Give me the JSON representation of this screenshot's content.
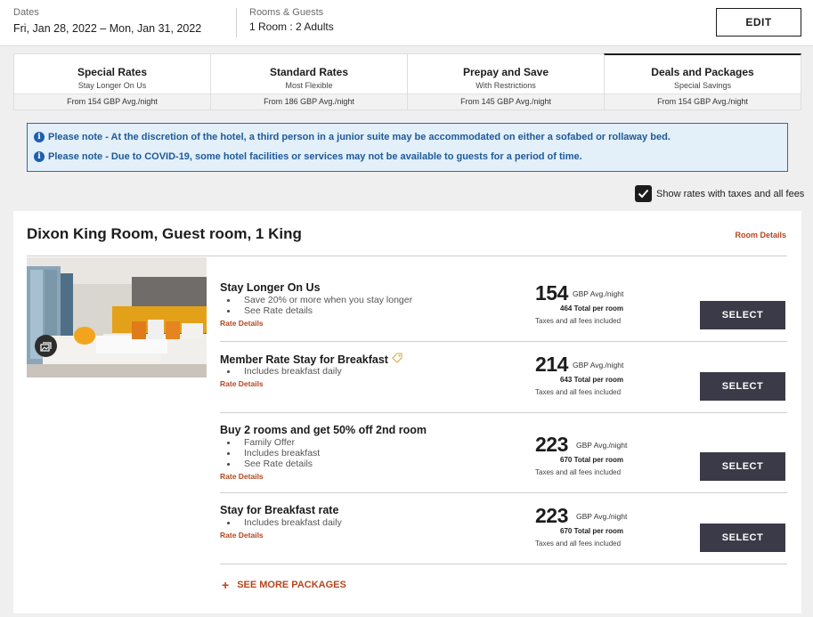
{
  "header": {
    "dates_label": "Dates",
    "dates_value": "Fri, Jan 28, 2022 – Mon, Jan 31, 2022",
    "guests_label": "Rooms & Guests",
    "guests_value": "1 Room : 2 Adults",
    "edit_label": "EDIT"
  },
  "tabs": [
    {
      "title": "Special Rates",
      "subtitle": "Stay Longer On Us",
      "from": "From 154 GBP Avg./night",
      "active": false
    },
    {
      "title": "Standard Rates",
      "subtitle": "Most Flexible",
      "from": "From 186 GBP Avg./night",
      "active": false
    },
    {
      "title": "Prepay and Save",
      "subtitle": "With Restrictions",
      "from": "From 145 GBP Avg./night",
      "active": false
    },
    {
      "title": "Deals and Packages",
      "subtitle": "Special Savings",
      "from": "From 154 GBP Avg./night",
      "active": true
    }
  ],
  "notices": [
    "Please note - At the discretion of the hotel, a third person in a junior suite may be accommodated on either a sofabed or rollaway bed.",
    "Please note - Due to COVID-19, some hotel facilities or services may not be available to guests for a period of time."
  ],
  "tax_toggle": {
    "label": "Show rates with taxes and all fees",
    "checked": true
  },
  "room": {
    "title": "Dixon King Room, Guest room, 1 King",
    "details_link": "Room Details",
    "rates": [
      {
        "title": "Stay Longer On Us",
        "bullets": [
          "Save 20% or more when you stay longer",
          "See Rate details"
        ],
        "link": "Rate Details",
        "price": "154",
        "unit": "GBP Avg./night",
        "total": "464",
        "total_label": "Total per room",
        "tax_note": "Taxes and all fees included",
        "select": "SELECT",
        "tag": false
      },
      {
        "title": "Member Rate Stay for Breakfast",
        "bullets": [
          "Includes breakfast daily"
        ],
        "link": "Rate Details",
        "price": "214",
        "unit": "GBP Avg./night",
        "total": "643",
        "total_label": "Total per room",
        "tax_note": "Taxes and all fees included",
        "select": "SELECT",
        "tag": true
      },
      {
        "title": "Buy 2 rooms and get 50% off 2nd room",
        "bullets": [
          "Family Offer",
          "Includes breakfast",
          "See Rate details"
        ],
        "link": "Rate Details",
        "price": "223",
        "unit": "GBP Avg./night",
        "total": "670",
        "total_label": "Total per room",
        "tax_note": "Taxes and all fees included",
        "select": "SELECT",
        "tag": false
      },
      {
        "title": "Stay for Breakfast rate",
        "bullets": [
          "Includes breakfast daily"
        ],
        "link": "Rate Details",
        "price": "223",
        "unit": "GBP Avg./night",
        "total": "670",
        "total_label": "Total per room",
        "tax_note": "Taxes and all fees included",
        "select": "SELECT",
        "tag": false
      }
    ],
    "more_packages": "SEE MORE PACKAGES"
  },
  "colors": {
    "accent": "#b4471f",
    "notice_text": "#1e5a99",
    "notice_bg": "#e3eff9",
    "select_bg": "#3a3a48"
  },
  "icons": {
    "notice": "info-icon",
    "gallery": "gallery-icon",
    "member": "tag-icon",
    "checkbox": "check-icon",
    "more": "plus-icon"
  }
}
